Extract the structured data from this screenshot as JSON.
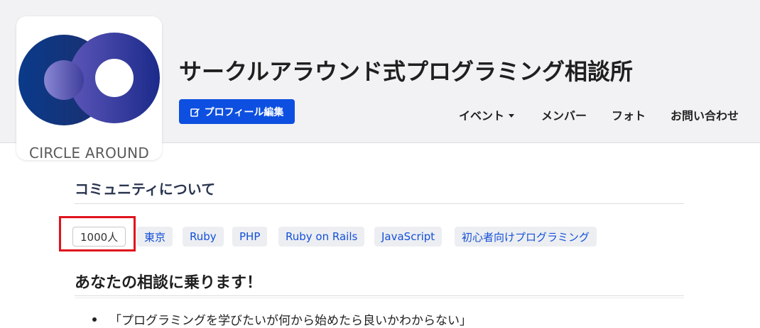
{
  "logo": {
    "wordmark": "CIRCLE AROUND",
    "icon": "circle-around-logo"
  },
  "header": {
    "title": "サークルアラウンド式プログラミング相談所",
    "edit_button_label": "プロフィール編集",
    "edit_icon": "edit-icon"
  },
  "nav": {
    "items": [
      {
        "label": "イベント",
        "has_dropdown": true
      },
      {
        "label": "メンバー"
      },
      {
        "label": "フォト"
      },
      {
        "label": "お問い合わせ"
      }
    ]
  },
  "about": {
    "heading": "コミュニティについて",
    "tags": [
      "1000人",
      "東京",
      "Ruby",
      "PHP",
      "Ruby on Rails",
      "JavaScript",
      "初心者向けプログラミング"
    ]
  },
  "content": {
    "heading": "あなたの相談に乗ります！",
    "bullets": [
      "「プログラミングを学びたいが何から始めたら良いかわからない」"
    ]
  },
  "colors": {
    "primary": "#0d4fe0",
    "tag_text": "#1450d8",
    "tag_bg": "#eceef2",
    "highlight": "#e0131c",
    "header_bg": "#f2f2f4"
  }
}
